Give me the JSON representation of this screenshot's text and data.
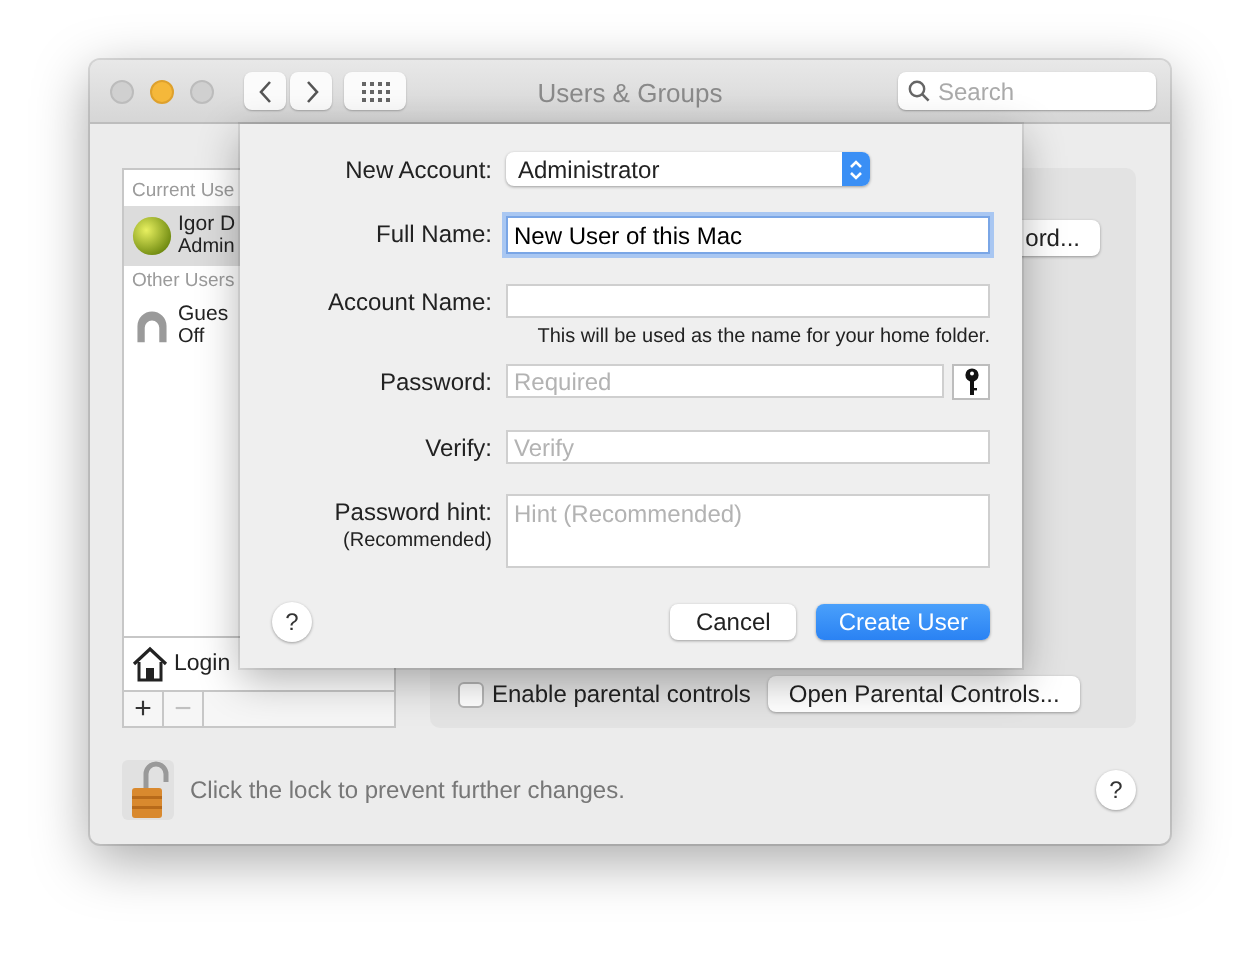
{
  "window": {
    "title": "Users & Groups"
  },
  "toolbar": {
    "search": {
      "placeholder": "Search"
    }
  },
  "sidebar": {
    "sections": [
      {
        "header": "Current Use",
        "users": [
          {
            "name": "Igor D",
            "role": "Admin",
            "selected": true,
            "kind": "ball"
          }
        ]
      },
      {
        "header": "Other Users",
        "users": [
          {
            "name": "Gues",
            "role": "Off",
            "selected": false,
            "kind": "silhouette"
          }
        ]
      }
    ],
    "login_options": "Login",
    "add_button": "+",
    "remove_button": {
      "label": "−",
      "disabled": true
    }
  },
  "panel": {
    "partial_button": "ord...",
    "parental_controls": {
      "label": "Enable parental controls",
      "checked": false
    },
    "open_button": "Open Parental Controls..."
  },
  "lock": {
    "text": "Click the lock to prevent further changes.",
    "locked": false
  },
  "help_button": "?",
  "sheet": {
    "fields": [
      {
        "kind": "popup",
        "label": "New Account:",
        "value": "Administrator"
      },
      {
        "kind": "text",
        "label": "Full Name:",
        "value": "New User of this Mac",
        "focused": true
      },
      {
        "kind": "text",
        "label": "Account Name:",
        "focused": false,
        "note": "This will be used as the name for your home folder."
      },
      {
        "kind": "password",
        "label": "Password:",
        "placeholder": "Required",
        "focused": false
      },
      {
        "kind": "text",
        "label": "Verify:",
        "placeholder": "Verify",
        "focused": false
      },
      {
        "kind": "textarea",
        "label": "Password hint:",
        "sublabel": "(Recommended)",
        "placeholder": "Hint (Recommended)",
        "focused": false
      }
    ],
    "help_button": "?",
    "buttons": [
      {
        "label": "Cancel",
        "default": false
      },
      {
        "label": "Create User",
        "default": true
      }
    ]
  }
}
